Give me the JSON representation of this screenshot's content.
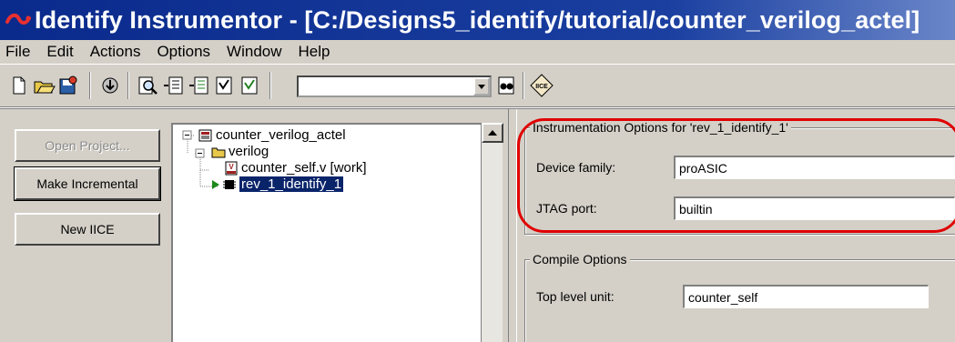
{
  "window": {
    "title": "Identify Instrumentor - [C:/Designs5_identify/tutorial/counter_verilog_actel]",
    "title_color": "#0a2a8c",
    "icon": "snake-logo-icon"
  },
  "menu": [
    "File",
    "Edit",
    "Actions",
    "Options",
    "Window",
    "Help"
  ],
  "toolbar": {
    "icons": [
      "new-file-icon",
      "open-folder-icon",
      "save-icon",
      "download-icon",
      "search-doc-icon",
      "instrument-icon-1",
      "instrument-icon-2",
      "instrument-icon-3",
      "instrument-icon-4",
      "find-binoculars-icon",
      "iice-icon"
    ],
    "combo_value": "",
    "iice_label": "IICE"
  },
  "actions": {
    "open_project": "Open Project...",
    "make_incremental": "Make Incremental",
    "new_iice": "New IICE"
  },
  "tree": {
    "root": "counter_verilog_actel",
    "folder": "verilog",
    "file": "counter_self.v [work]",
    "implementation": "rev_1_identify_1"
  },
  "instrumentation": {
    "group_title": "Instrumentation Options for 'rev_1_identify_1'",
    "device_family_label": "Device family:",
    "device_family_value": "proASIC",
    "jtag_port_label": "JTAG port:",
    "jtag_port_value": "builtin"
  },
  "compile": {
    "group_title": "Compile Options",
    "top_level_label": "Top level unit:",
    "top_level_value": "counter_self"
  },
  "colors": {
    "selection": "#0a246a",
    "annotation_ring": "#e00000",
    "face": "#d4d0c8"
  }
}
